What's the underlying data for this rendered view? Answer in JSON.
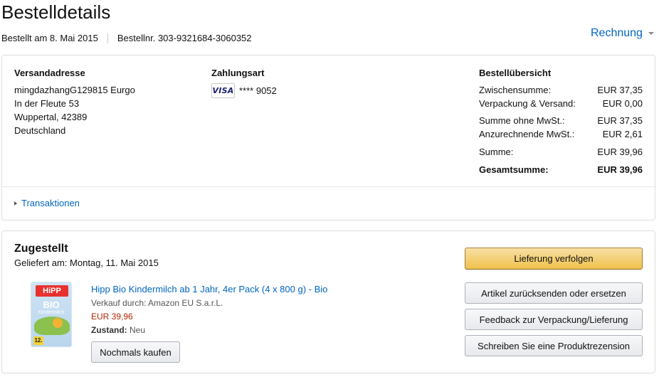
{
  "header": {
    "title": "Bestelldetails",
    "ordered_on": "Bestellt am 8. Mai 2015",
    "order_number": "Bestellnr. 303-9321684-3060352",
    "invoice_label": "Rechnung"
  },
  "shipping": {
    "title": "Versandadresse",
    "lines": [
      "mingdazhangG129815 Eurgo",
      "In der Fleute 53",
      "Wuppertal, 42389",
      "Deutschland"
    ]
  },
  "payment": {
    "title": "Zahlungsart",
    "card_brand": "VISA",
    "card_digits": "**** 9052"
  },
  "summary": {
    "title": "Bestellübersicht",
    "rows": [
      {
        "label": "Zwischensumme:",
        "value": "EUR 37,35"
      },
      {
        "label": "Verpackung & Versand:",
        "value": "EUR 0,00"
      },
      {
        "label": "Summe ohne MwSt.:",
        "value": "EUR 37,35"
      },
      {
        "label": "Anzurechnende MwSt.:",
        "value": "EUR 2,61"
      },
      {
        "label": "Summe:",
        "value": "EUR 39,96"
      }
    ],
    "total": {
      "label": "Gesamtsumme:",
      "value": "EUR 39,96"
    }
  },
  "transactions_label": "Transaktionen",
  "shipment": {
    "status": "Zugestellt",
    "delivered_on": "Geliefert am: Montag, 11. Mai 2015",
    "product": {
      "title": "Hipp Bio Kindermilch ab 1 Jahr, 4er Pack (4 x 800 g) - Bio",
      "seller": "Verkauf durch: Amazon EU S.a.r.L.",
      "price": "EUR 39,96",
      "condition_label": "Zustand:",
      "condition_value": "Neu",
      "image_brand": "HiPP",
      "image_bio": "BIO",
      "image_sub": "Kindermilch",
      "image_badge": "12."
    },
    "buy_again_label": "Nochmals kaufen",
    "actions": {
      "track": "Lieferung verfolgen",
      "return": "Artikel zurücksenden oder ersetzen",
      "feedback": "Feedback zur Verpackung/Lieferung",
      "review": "Schreiben Sie eine Produktrezension"
    }
  },
  "colors": {
    "link": "#0066c0",
    "price": "#b12704",
    "primary_button": "#f0c14b"
  }
}
